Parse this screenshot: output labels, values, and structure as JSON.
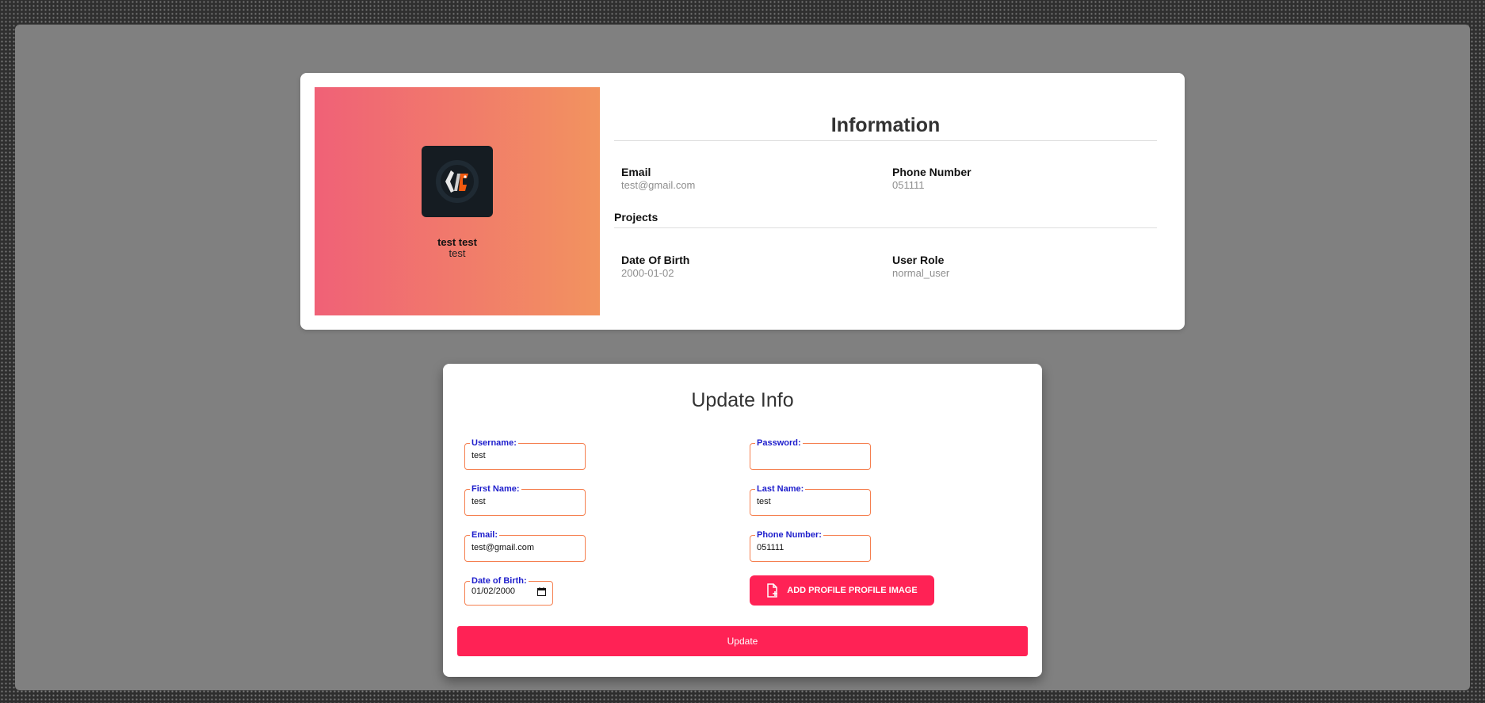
{
  "profile": {
    "full_name": "test test",
    "username": "test",
    "gradient": [
      "#f06177",
      "#f2935f"
    ]
  },
  "information": {
    "title": "Information",
    "email_label": "Email",
    "email_value": "test@gmail.com",
    "phone_label": "Phone Number",
    "phone_value": "051111",
    "projects_label": "Projects",
    "dob_label": "Date Of Birth",
    "dob_value": "2000-01-02",
    "role_label": "User Role",
    "role_value": "normal_user"
  },
  "update_form": {
    "title": "Update Info",
    "username": {
      "label": "Username:",
      "value": "test"
    },
    "password": {
      "label": "Password:",
      "value": ""
    },
    "first_name": {
      "label": "First Name:",
      "value": "test"
    },
    "last_name": {
      "label": "Last Name:",
      "value": "test"
    },
    "email": {
      "label": "Email:",
      "value": "test@gmail.com"
    },
    "phone": {
      "label": "Phone Number:",
      "value": "051111"
    },
    "dob": {
      "label": "Date of Birth:",
      "value": "01/02/2000"
    },
    "add_image_label": "ADD PROFILE PROFILE IMAGE",
    "update_label": "Update",
    "accent_color": "#ff2255",
    "field_border_color": "#f57f4f",
    "label_color": "#1d1dcc"
  },
  "icons": [
    "logo-icon",
    "calendar-icon",
    "file-add-icon"
  ]
}
